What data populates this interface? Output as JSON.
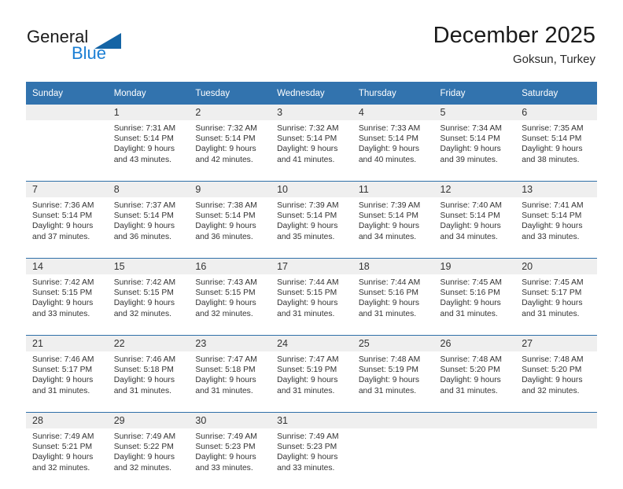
{
  "brand": {
    "name_top": "General",
    "name_bottom": "Blue",
    "triangle_icon": "triangle-logo-icon",
    "color_dark": "#1b1b1b",
    "color_blue": "#1b7fd4",
    "color_triangle": "#1464a5"
  },
  "header": {
    "title": "December 2025",
    "subtitle": "Goksun, Turkey"
  },
  "colors": {
    "header_row_bg": "#3273ae",
    "header_row_text": "#ffffff",
    "day_number_band": "#efefef",
    "week_separator": "#2f6fa8",
    "body_text": "#333333"
  },
  "weekday_headers": [
    "Sunday",
    "Monday",
    "Tuesday",
    "Wednesday",
    "Thursday",
    "Friday",
    "Saturday"
  ],
  "weeks": [
    {
      "days": [
        {
          "num": "",
          "sunrise": "",
          "sunset": "",
          "daylight_1": "",
          "daylight_2": ""
        },
        {
          "num": "1",
          "sunrise": "Sunrise: 7:31 AM",
          "sunset": "Sunset: 5:14 PM",
          "daylight_1": "Daylight: 9 hours",
          "daylight_2": "and 43 minutes."
        },
        {
          "num": "2",
          "sunrise": "Sunrise: 7:32 AM",
          "sunset": "Sunset: 5:14 PM",
          "daylight_1": "Daylight: 9 hours",
          "daylight_2": "and 42 minutes."
        },
        {
          "num": "3",
          "sunrise": "Sunrise: 7:32 AM",
          "sunset": "Sunset: 5:14 PM",
          "daylight_1": "Daylight: 9 hours",
          "daylight_2": "and 41 minutes."
        },
        {
          "num": "4",
          "sunrise": "Sunrise: 7:33 AM",
          "sunset": "Sunset: 5:14 PM",
          "daylight_1": "Daylight: 9 hours",
          "daylight_2": "and 40 minutes."
        },
        {
          "num": "5",
          "sunrise": "Sunrise: 7:34 AM",
          "sunset": "Sunset: 5:14 PM",
          "daylight_1": "Daylight: 9 hours",
          "daylight_2": "and 39 minutes."
        },
        {
          "num": "6",
          "sunrise": "Sunrise: 7:35 AM",
          "sunset": "Sunset: 5:14 PM",
          "daylight_1": "Daylight: 9 hours",
          "daylight_2": "and 38 minutes."
        }
      ]
    },
    {
      "days": [
        {
          "num": "7",
          "sunrise": "Sunrise: 7:36 AM",
          "sunset": "Sunset: 5:14 PM",
          "daylight_1": "Daylight: 9 hours",
          "daylight_2": "and 37 minutes."
        },
        {
          "num": "8",
          "sunrise": "Sunrise: 7:37 AM",
          "sunset": "Sunset: 5:14 PM",
          "daylight_1": "Daylight: 9 hours",
          "daylight_2": "and 36 minutes."
        },
        {
          "num": "9",
          "sunrise": "Sunrise: 7:38 AM",
          "sunset": "Sunset: 5:14 PM",
          "daylight_1": "Daylight: 9 hours",
          "daylight_2": "and 36 minutes."
        },
        {
          "num": "10",
          "sunrise": "Sunrise: 7:39 AM",
          "sunset": "Sunset: 5:14 PM",
          "daylight_1": "Daylight: 9 hours",
          "daylight_2": "and 35 minutes."
        },
        {
          "num": "11",
          "sunrise": "Sunrise: 7:39 AM",
          "sunset": "Sunset: 5:14 PM",
          "daylight_1": "Daylight: 9 hours",
          "daylight_2": "and 34 minutes."
        },
        {
          "num": "12",
          "sunrise": "Sunrise: 7:40 AM",
          "sunset": "Sunset: 5:14 PM",
          "daylight_1": "Daylight: 9 hours",
          "daylight_2": "and 34 minutes."
        },
        {
          "num": "13",
          "sunrise": "Sunrise: 7:41 AM",
          "sunset": "Sunset: 5:14 PM",
          "daylight_1": "Daylight: 9 hours",
          "daylight_2": "and 33 minutes."
        }
      ]
    },
    {
      "days": [
        {
          "num": "14",
          "sunrise": "Sunrise: 7:42 AM",
          "sunset": "Sunset: 5:15 PM",
          "daylight_1": "Daylight: 9 hours",
          "daylight_2": "and 33 minutes."
        },
        {
          "num": "15",
          "sunrise": "Sunrise: 7:42 AM",
          "sunset": "Sunset: 5:15 PM",
          "daylight_1": "Daylight: 9 hours",
          "daylight_2": "and 32 minutes."
        },
        {
          "num": "16",
          "sunrise": "Sunrise: 7:43 AM",
          "sunset": "Sunset: 5:15 PM",
          "daylight_1": "Daylight: 9 hours",
          "daylight_2": "and 32 minutes."
        },
        {
          "num": "17",
          "sunrise": "Sunrise: 7:44 AM",
          "sunset": "Sunset: 5:15 PM",
          "daylight_1": "Daylight: 9 hours",
          "daylight_2": "and 31 minutes."
        },
        {
          "num": "18",
          "sunrise": "Sunrise: 7:44 AM",
          "sunset": "Sunset: 5:16 PM",
          "daylight_1": "Daylight: 9 hours",
          "daylight_2": "and 31 minutes."
        },
        {
          "num": "19",
          "sunrise": "Sunrise: 7:45 AM",
          "sunset": "Sunset: 5:16 PM",
          "daylight_1": "Daylight: 9 hours",
          "daylight_2": "and 31 minutes."
        },
        {
          "num": "20",
          "sunrise": "Sunrise: 7:45 AM",
          "sunset": "Sunset: 5:17 PM",
          "daylight_1": "Daylight: 9 hours",
          "daylight_2": "and 31 minutes."
        }
      ]
    },
    {
      "days": [
        {
          "num": "21",
          "sunrise": "Sunrise: 7:46 AM",
          "sunset": "Sunset: 5:17 PM",
          "daylight_1": "Daylight: 9 hours",
          "daylight_2": "and 31 minutes."
        },
        {
          "num": "22",
          "sunrise": "Sunrise: 7:46 AM",
          "sunset": "Sunset: 5:18 PM",
          "daylight_1": "Daylight: 9 hours",
          "daylight_2": "and 31 minutes."
        },
        {
          "num": "23",
          "sunrise": "Sunrise: 7:47 AM",
          "sunset": "Sunset: 5:18 PM",
          "daylight_1": "Daylight: 9 hours",
          "daylight_2": "and 31 minutes."
        },
        {
          "num": "24",
          "sunrise": "Sunrise: 7:47 AM",
          "sunset": "Sunset: 5:19 PM",
          "daylight_1": "Daylight: 9 hours",
          "daylight_2": "and 31 minutes."
        },
        {
          "num": "25",
          "sunrise": "Sunrise: 7:48 AM",
          "sunset": "Sunset: 5:19 PM",
          "daylight_1": "Daylight: 9 hours",
          "daylight_2": "and 31 minutes."
        },
        {
          "num": "26",
          "sunrise": "Sunrise: 7:48 AM",
          "sunset": "Sunset: 5:20 PM",
          "daylight_1": "Daylight: 9 hours",
          "daylight_2": "and 31 minutes."
        },
        {
          "num": "27",
          "sunrise": "Sunrise: 7:48 AM",
          "sunset": "Sunset: 5:20 PM",
          "daylight_1": "Daylight: 9 hours",
          "daylight_2": "and 32 minutes."
        }
      ]
    },
    {
      "days": [
        {
          "num": "28",
          "sunrise": "Sunrise: 7:49 AM",
          "sunset": "Sunset: 5:21 PM",
          "daylight_1": "Daylight: 9 hours",
          "daylight_2": "and 32 minutes."
        },
        {
          "num": "29",
          "sunrise": "Sunrise: 7:49 AM",
          "sunset": "Sunset: 5:22 PM",
          "daylight_1": "Daylight: 9 hours",
          "daylight_2": "and 32 minutes."
        },
        {
          "num": "30",
          "sunrise": "Sunrise: 7:49 AM",
          "sunset": "Sunset: 5:23 PM",
          "daylight_1": "Daylight: 9 hours",
          "daylight_2": "and 33 minutes."
        },
        {
          "num": "31",
          "sunrise": "Sunrise: 7:49 AM",
          "sunset": "Sunset: 5:23 PM",
          "daylight_1": "Daylight: 9 hours",
          "daylight_2": "and 33 minutes."
        },
        {
          "num": "",
          "sunrise": "",
          "sunset": "",
          "daylight_1": "",
          "daylight_2": ""
        },
        {
          "num": "",
          "sunrise": "",
          "sunset": "",
          "daylight_1": "",
          "daylight_2": ""
        },
        {
          "num": "",
          "sunrise": "",
          "sunset": "",
          "daylight_1": "",
          "daylight_2": ""
        }
      ]
    }
  ]
}
